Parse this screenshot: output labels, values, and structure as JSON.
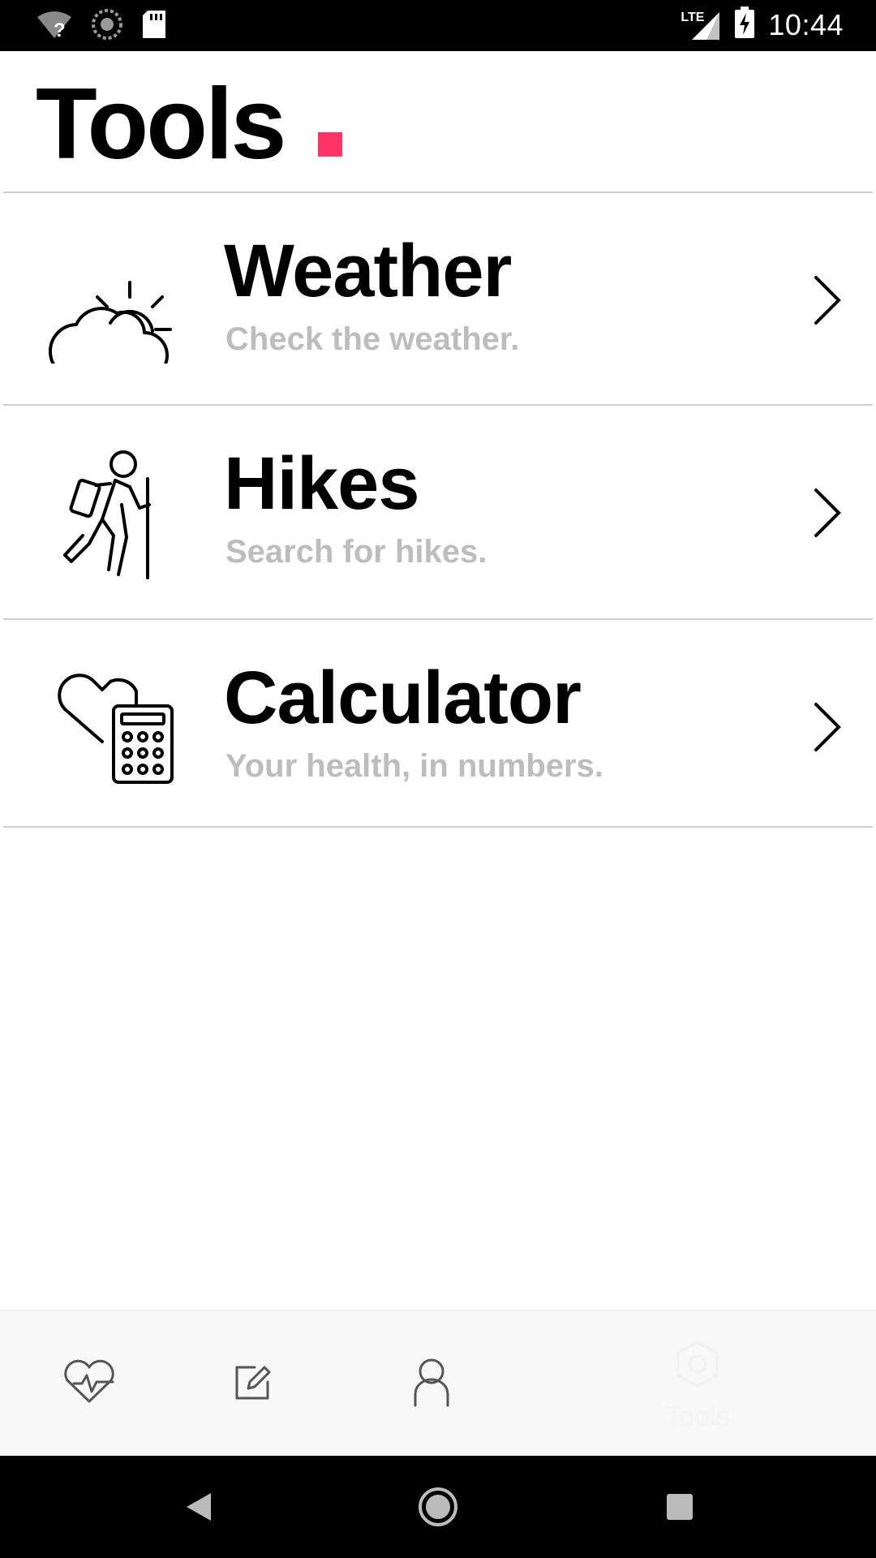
{
  "status_bar": {
    "time": "10:44",
    "network_label": "LTE",
    "icons": [
      "wifi-unknown-icon",
      "sync-icon",
      "sd-card-icon",
      "lte-signal-icon",
      "battery-charging-icon"
    ]
  },
  "header": {
    "title": "Tools",
    "accent_color": "#ff3366"
  },
  "tools": [
    {
      "title": "Weather",
      "subtitle": "Check the weather.",
      "icon": "weather-icon"
    },
    {
      "title": "Hikes",
      "subtitle": "Search for hikes.",
      "icon": "hiker-icon"
    },
    {
      "title": "Calculator",
      "subtitle": "Your health, in numbers.",
      "icon": "health-calculator-icon"
    }
  ],
  "bottom_nav": {
    "items": [
      {
        "icon": "heart-pulse-icon",
        "label": ""
      },
      {
        "icon": "edit-icon",
        "label": ""
      },
      {
        "icon": "profile-icon",
        "label": ""
      },
      {
        "icon": "hexagon-icon",
        "label": "Tools",
        "active": true
      }
    ]
  },
  "colors": {
    "subtitle": "#bdbdbd",
    "divider": "#cfcfcf",
    "nav_background": "#f8f8f8"
  }
}
